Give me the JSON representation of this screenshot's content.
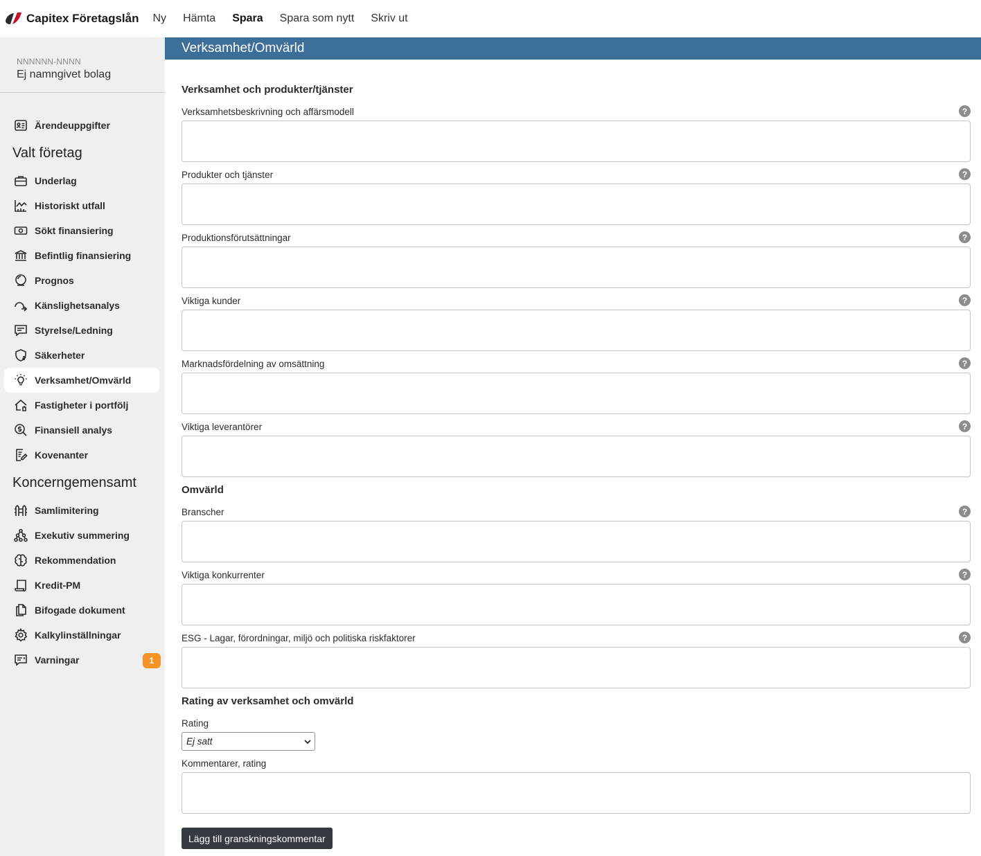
{
  "app": {
    "brand": "Capitex Företagslån"
  },
  "nav": [
    {
      "label": "Ny",
      "active": false
    },
    {
      "label": "Hämta",
      "active": false
    },
    {
      "label": "Spara",
      "active": true
    },
    {
      "label": "Spara som nytt",
      "active": false
    },
    {
      "label": "Skriv ut",
      "active": false
    }
  ],
  "company": {
    "id": "NNNNNN-NNNN",
    "name": "Ej namngivet bolag"
  },
  "sidebar": {
    "top_item": {
      "label": "Ärendeuppgifter",
      "icon": "id-card-icon"
    },
    "heading_valt": "Valt företag",
    "valt_items": [
      {
        "label": "Underlag",
        "icon": "briefcase-icon"
      },
      {
        "label": "Historiskt utfall",
        "icon": "chart-icon"
      },
      {
        "label": "Sökt finansiering",
        "icon": "money-icon"
      },
      {
        "label": "Befintlig finansiering",
        "icon": "bank-icon"
      },
      {
        "label": "Prognos",
        "icon": "crystal-ball-icon"
      },
      {
        "label": "Känslighetsanalys",
        "icon": "route-icon"
      },
      {
        "label": "Styrelse/Ledning",
        "icon": "message-icon"
      },
      {
        "label": "Säkerheter",
        "icon": "shield-dollar-icon"
      },
      {
        "label": "Verksamhet/Omvärld",
        "icon": "lightbulb-icon",
        "active": true
      },
      {
        "label": "Fastigheter i portfölj",
        "icon": "house-icon"
      },
      {
        "label": "Finansiell analys",
        "icon": "search-dollar-icon"
      },
      {
        "label": "Kovenanter",
        "icon": "document-edit-icon"
      }
    ],
    "heading_koncern": "Koncerngemensamt",
    "koncern_items": [
      {
        "label": "Samlimitering",
        "icon": "fence-icon"
      },
      {
        "label": "Exekutiv summering",
        "icon": "hierarchy-icon"
      },
      {
        "label": "Rekommendation",
        "icon": "brain-icon"
      },
      {
        "label": "Kredit-PM",
        "icon": "scroll-icon"
      },
      {
        "label": "Bifogade dokument",
        "icon": "files-icon"
      },
      {
        "label": "Kalkylinställningar",
        "icon": "gear-icon"
      },
      {
        "label": "Varningar",
        "icon": "warning-message-icon",
        "badge": "1"
      }
    ]
  },
  "page": {
    "title": "Verksamhet/Omvärld"
  },
  "section1": {
    "title": "Verksamhet och produkter/tjänster",
    "fields": [
      {
        "label": "Verksamhetsbeskrivning och affärsmodell",
        "value": ""
      },
      {
        "label": "Produkter och tjänster",
        "value": ""
      },
      {
        "label": "Produktionsförutsättningar",
        "value": ""
      },
      {
        "label": "Viktiga kunder",
        "value": ""
      },
      {
        "label": "Marknadsfördelning av omsättning",
        "value": ""
      },
      {
        "label": "Viktiga leverantörer",
        "value": ""
      }
    ]
  },
  "section2": {
    "title": "Omvärld",
    "fields": [
      {
        "label": "Branscher",
        "value": ""
      },
      {
        "label": "Viktiga konkurrenter",
        "value": ""
      },
      {
        "label": "ESG - Lagar, förordningar, miljö och politiska riskfaktorer",
        "value": ""
      }
    ]
  },
  "section3": {
    "title": "Rating av verksamhet och omvärld",
    "rating_label": "Rating",
    "rating_value": "Ej satt",
    "comment_label": "Kommentarer, rating",
    "comment_value": ""
  },
  "help_symbol": "?",
  "buttons": {
    "add_review": "Lägg till granskningskommentar"
  },
  "colors": {
    "header_bg": "#3c6e9a",
    "badge": "#f39328",
    "button_bg": "#343a40",
    "sidebar_bg": "#efefef"
  }
}
